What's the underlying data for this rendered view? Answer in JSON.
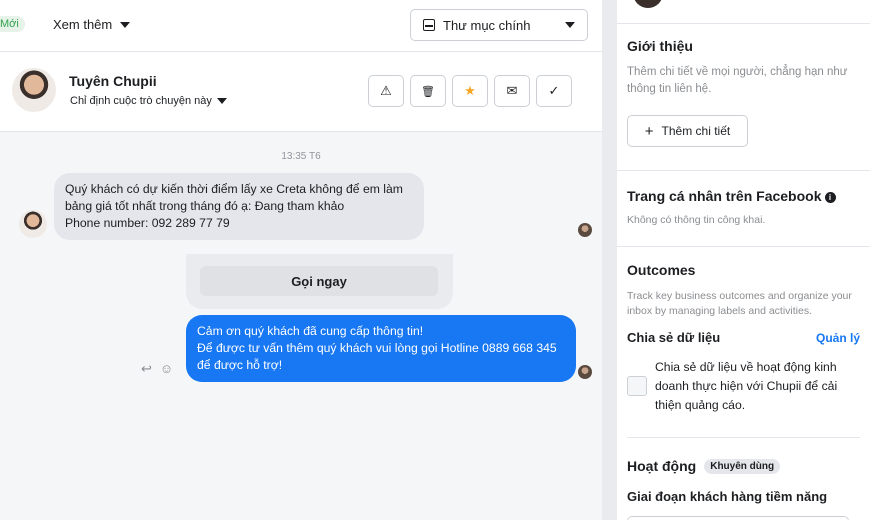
{
  "header": {
    "new_badge": "Mới",
    "see_more": "Xem thêm",
    "folder": "Thư mục chính"
  },
  "contact": {
    "name": "Tuyên Chupii",
    "assign": "Chỉ định cuộc trò chuyện này",
    "actions": {
      "warning": "⚠",
      "delete": "🗑",
      "star": "★",
      "mail": "✉",
      "done": "✓"
    }
  },
  "thread": {
    "timestamp": "13:35 T6",
    "incoming": [
      "Quý khách có dự kiến thời điểm lấy xe Creta không để em làm",
      "bảng giá tốt nhất trong tháng đó ạ: Đang tham khảo",
      "Phone number: 092 289 77 79"
    ],
    "cta": "Gọi ngay",
    "outgoing": [
      "Cảm ơn quý khách đã cung cấp thông tin!",
      "Để được tư vấn thêm quý khách vui lòng gọi Hotline 0889 668 345",
      "để được hỗ trợ!"
    ],
    "tools": {
      "reply": "↩",
      "emoji": "☺"
    }
  },
  "sidebar": {
    "intro_title": "Giới thiệu",
    "intro_desc": "Thêm chi tiết về mọi người, chẳng hạn như thông tin liên hệ.",
    "add_detail": "Thêm chi tiết",
    "add_icon": "+",
    "fb_title": "Trang cá nhân trên Facebook",
    "fb_info": "i",
    "fb_desc": "Không có thông tin công khai.",
    "outcomes_title": "Outcomes",
    "outcomes_desc": "Track key business outcomes and organize your inbox by managing labels and activities.",
    "share_title": "Chia sẻ dữ liệu",
    "manage": "Quản lý",
    "share_desc": "Chia sẻ dữ liệu về hoạt động kinh doanh thực hiện với Chupii để cải thiện quảng cáo.",
    "activity_title": "Hoạt động",
    "recommended": "Khuyên dùng",
    "stage_title": "Giai đoạn khách hàng tiềm năng"
  },
  "colors": {
    "accent": "#1877f2",
    "thread_bg": "#f5f6f7",
    "star": "#f5a623",
    "new_badge_text": "#31a24c"
  }
}
